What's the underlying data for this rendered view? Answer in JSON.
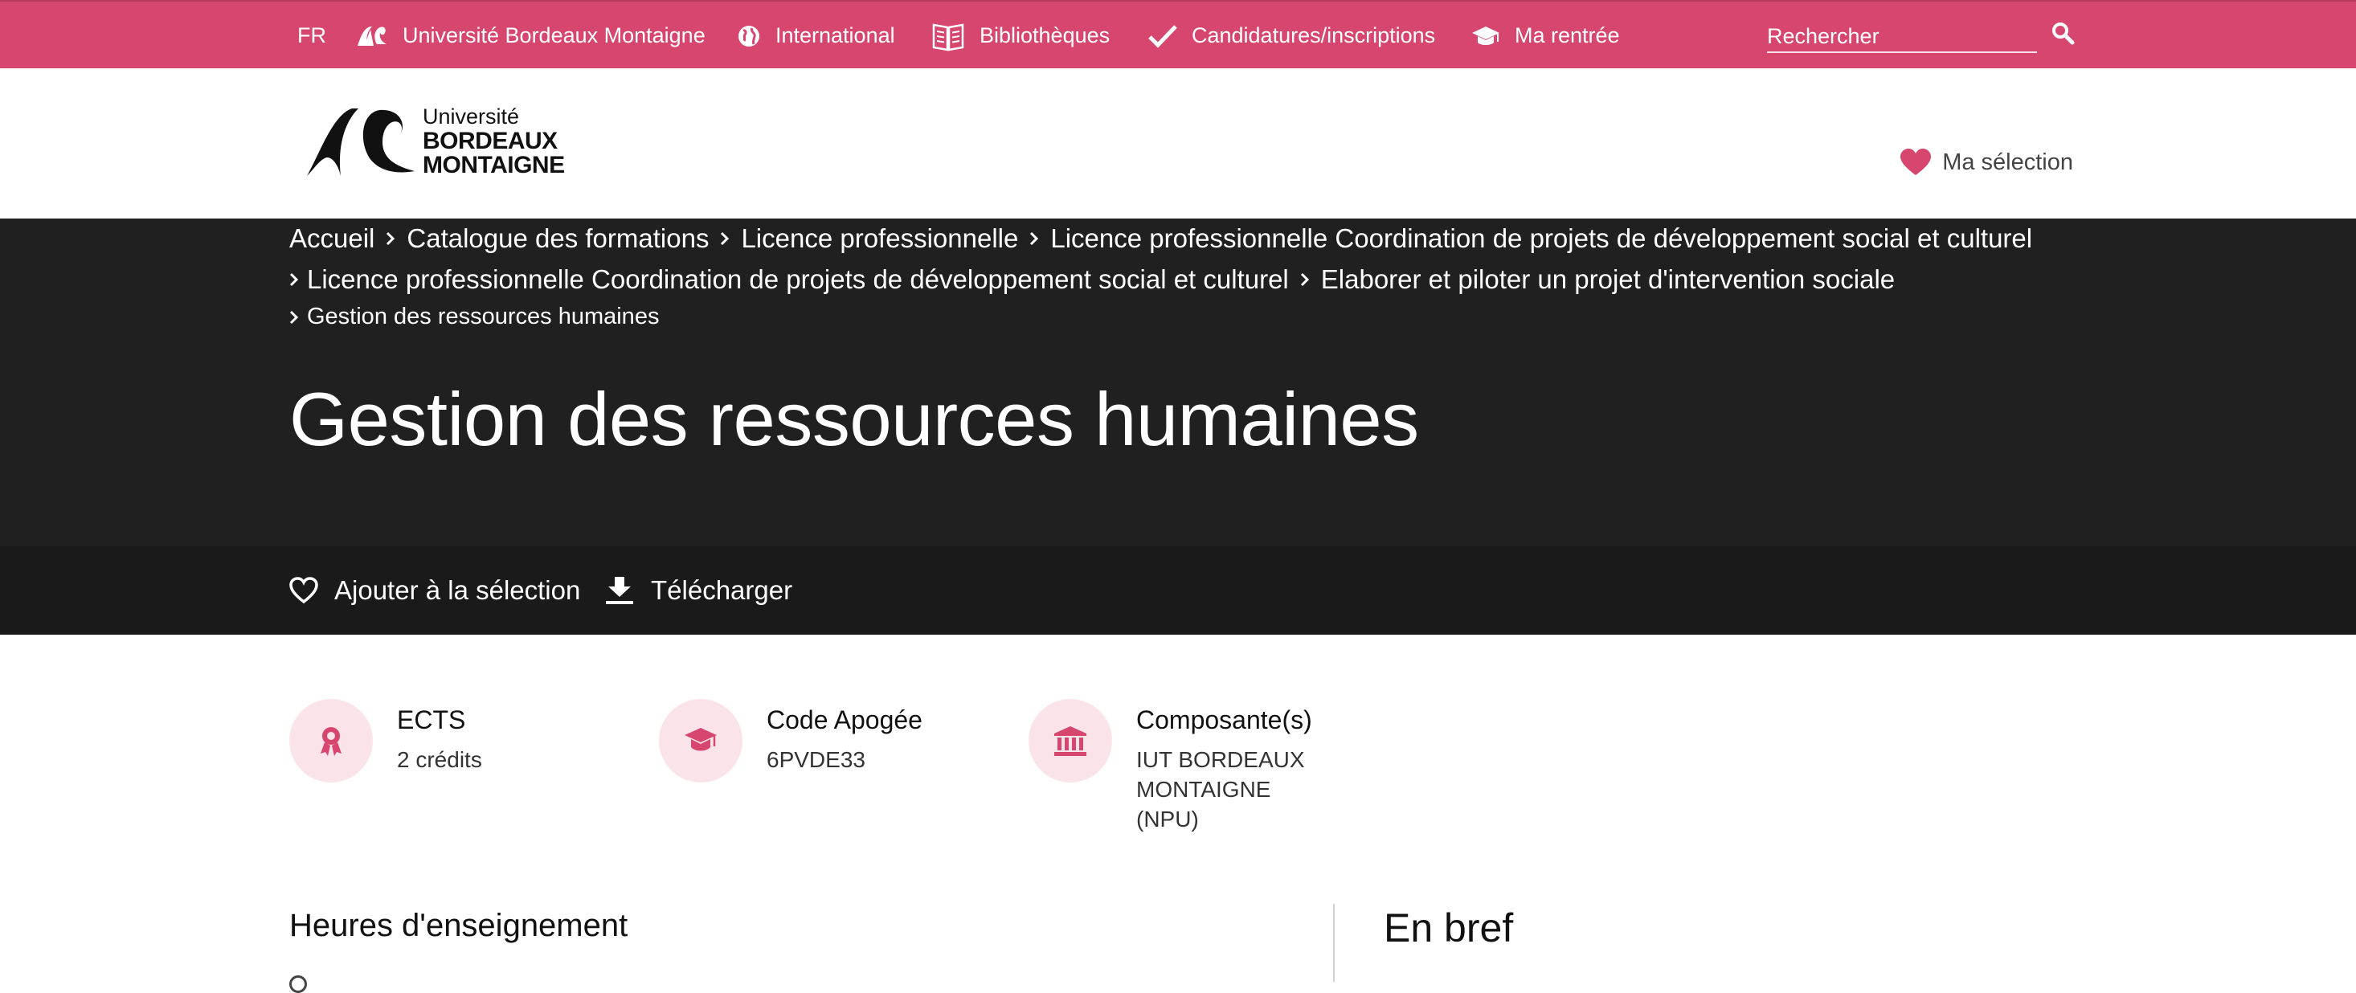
{
  "topbar": {
    "lang": "FR",
    "links": [
      {
        "label": "Université Bordeaux Montaigne",
        "icon": "ubm-logo-icon"
      },
      {
        "label": "International",
        "icon": "globe-icon"
      },
      {
        "label": "Bibliothèques",
        "icon": "book-icon"
      },
      {
        "label": "Candidatures/inscriptions",
        "icon": "check-icon"
      },
      {
        "label": "Ma rentrée",
        "icon": "graduation-cap-icon"
      }
    ],
    "search_placeholder": "Rechercher",
    "background": "#d6466f"
  },
  "header": {
    "logo": {
      "line1": "Université",
      "line2": "BORDEAUX",
      "line3": "MONTAIGNE"
    },
    "selection_label": "Ma sélection",
    "heart_color": "#d6466f"
  },
  "breadcrumb": {
    "items": [
      "Accueil",
      "Catalogue des formations",
      "Licence professionnelle",
      "Licence professionnelle Coordination de projets de développement social et culturel",
      "Licence professionnelle Coordination de projets de développement social et culturel",
      "Elaborer et piloter un projet d'intervention sociale",
      "Gestion des ressources humaines"
    ]
  },
  "page": {
    "title": "Gestion des ressources humaines"
  },
  "actions": {
    "add_selection": "Ajouter à la sélection",
    "download": "Télécharger"
  },
  "info": [
    {
      "title": "ECTS",
      "value": "2 crédits",
      "icon": "award-icon"
    },
    {
      "title": "Code Apogée",
      "value": "6PVDE33",
      "icon": "graduation-cap-icon"
    },
    {
      "title": "Composante(s)",
      "value_lines": [
        "IUT BORDEAUX",
        "MONTAIGNE",
        "(NPU)"
      ],
      "icon": "institution-icon"
    }
  ],
  "sections": {
    "hours_title": "Heures d'enseignement",
    "brief_title": "En bref"
  },
  "colors": {
    "accent": "#d6466f",
    "accent_light": "#fbe3ea",
    "hero": "#202020",
    "actionbar": "#1a1a1a"
  }
}
